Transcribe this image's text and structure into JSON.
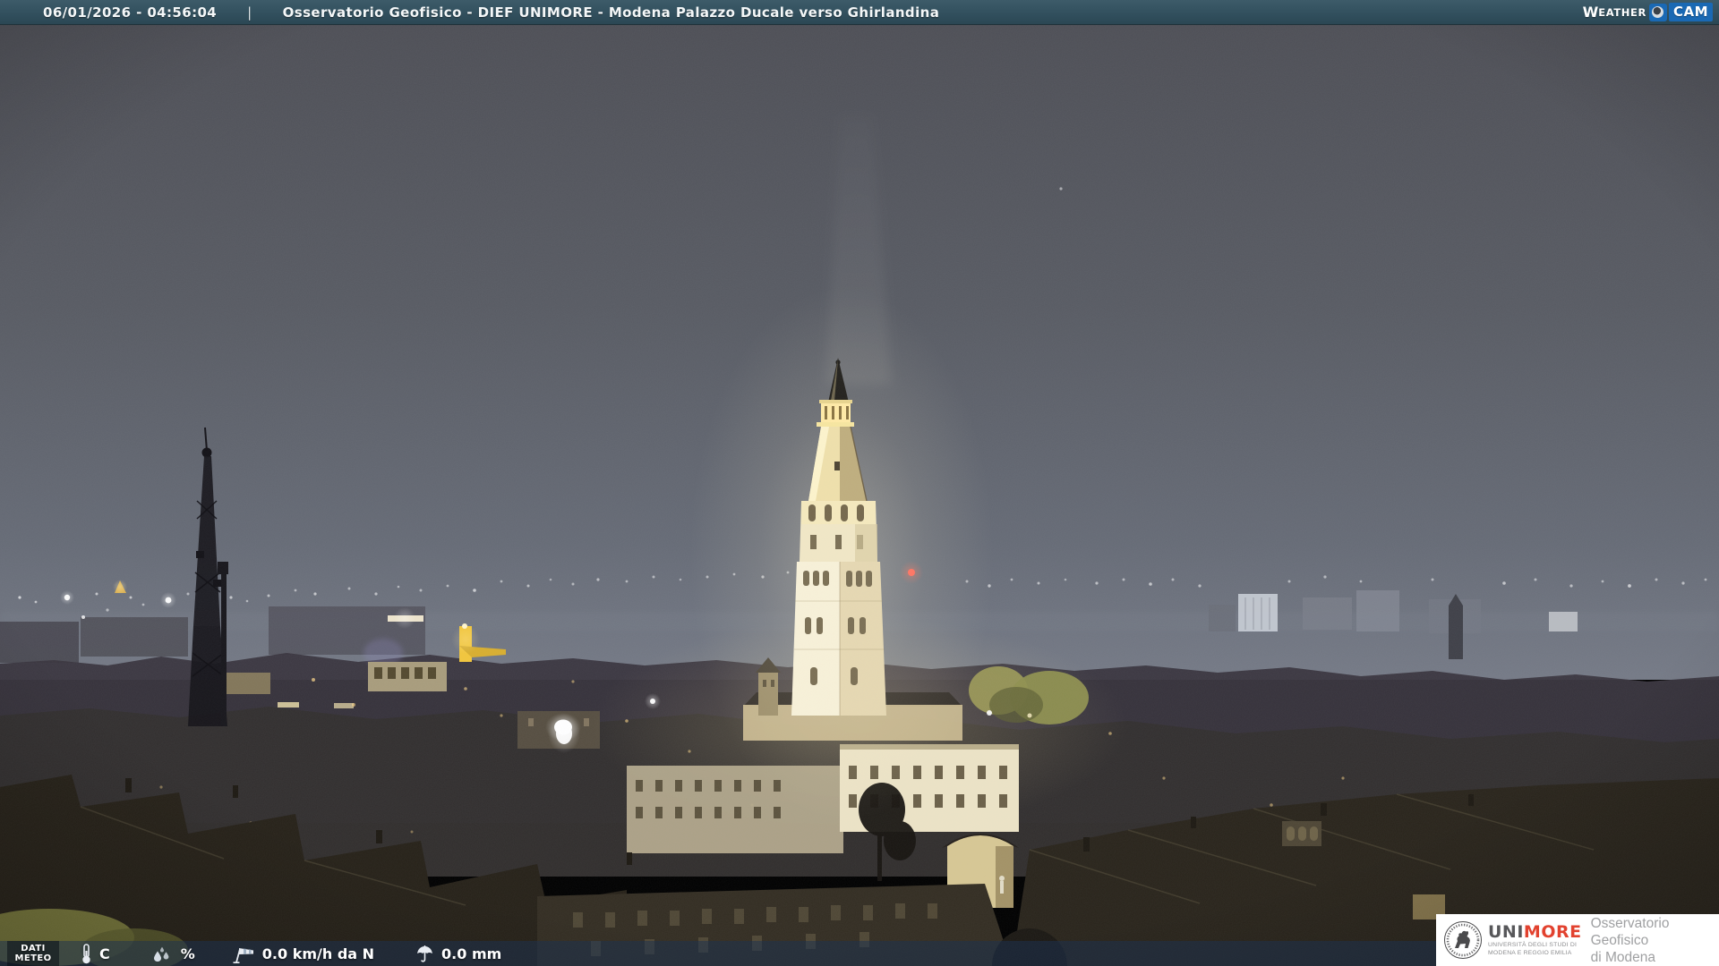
{
  "header": {
    "datetime": "06/01/2026 - 04:56:04",
    "separator": "|",
    "title": "Osservatorio Geofisico - DIEF UNIMORE - Modena Palazzo Ducale verso Ghirlandina"
  },
  "weathercam_logo": {
    "word_initial": "W",
    "word_rest": "EATHER",
    "cam": "CAM",
    "lens_icon": "camera-lens-icon",
    "accent_blue": "#1a69b4"
  },
  "weather_bar": {
    "label": {
      "line1": "DATI",
      "line2": "METEO"
    },
    "temperature": {
      "icon": "thermometer-icon",
      "value": "",
      "unit": "C"
    },
    "humidity": {
      "icon": "humidity-icon",
      "value": "",
      "unit": "%"
    },
    "wind": {
      "icon": "windsock-icon",
      "text": "0.0 km/h da N"
    },
    "rain": {
      "icon": "umbrella-icon",
      "text": "0.0 mm"
    }
  },
  "logo_box": {
    "seal_icon": "unimore-seal-icon",
    "brand": {
      "uni": "UNI",
      "more": "MORE",
      "sub_line1": "UNIVERSITÀ DEGLI STUDI DI",
      "sub_line2": "MODENA E REGGIO EMILIA",
      "more_color": "#e2422f"
    },
    "org": {
      "line1": "Osservatorio Geofisico",
      "line2": "di Modena"
    }
  },
  "scene_colors": {
    "header_bar": "#32505e",
    "sky_top": "#4d4e55",
    "sky_horizon": "#7a7e89",
    "tower_light": "#f8f1d6",
    "bar_overlay": "rgba(28,50,80,0.52)"
  }
}
